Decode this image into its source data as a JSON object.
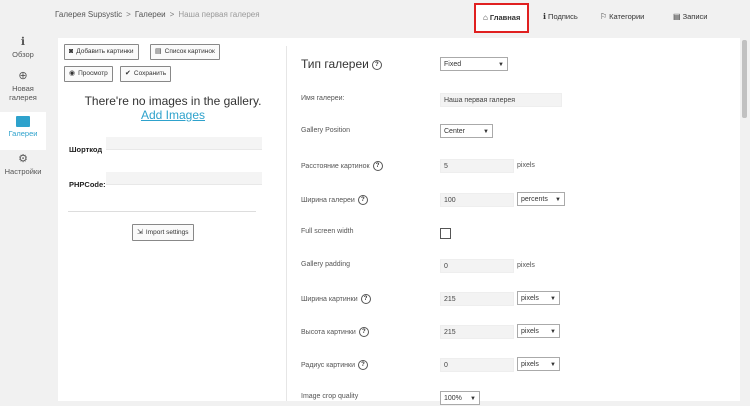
{
  "breadcrumb": {
    "root": "Галерея Supsystic",
    "section": "Галереи",
    "current": "Наша первая галерея",
    "separator": ">"
  },
  "topnav": {
    "home": {
      "icon": "home-icon",
      "glyph": "⌂",
      "label": "Главная"
    },
    "caption": {
      "icon": "info-icon",
      "glyph": "ℹ",
      "label": "Подпись"
    },
    "categories": {
      "icon": "bookmark-icon",
      "glyph": "⚐",
      "label": "Категории"
    },
    "posts": {
      "icon": "list-icon",
      "glyph": "▤",
      "label": "Записи"
    }
  },
  "sidebar": {
    "items": [
      {
        "icon": "info-icon",
        "glyph": "ℹ",
        "label": "Обзор"
      },
      {
        "icon": "plus-circle-icon",
        "glyph": "⊕",
        "label": "Новая галерея"
      },
      {
        "icon": "gallery-icon",
        "glyph": "",
        "label": "Галереи"
      },
      {
        "icon": "gear-icon",
        "glyph": "⚙",
        "label": "Настройки"
      }
    ]
  },
  "left_panel": {
    "buttons": {
      "add_images": {
        "icon": "camera-icon",
        "glyph": "◙",
        "label": "Добавить картинки"
      },
      "image_list": {
        "icon": "list-icon",
        "glyph": "▤",
        "label": "Список картинок"
      },
      "preview": {
        "icon": "eye-icon",
        "glyph": "◉",
        "label": "Просмотр"
      },
      "save": {
        "icon": "check-icon",
        "glyph": "✔",
        "label": "Сохранить"
      }
    },
    "empty_message": "There're no images in the gallery.",
    "add_images_link": "Add Images",
    "shortcode_label": "Шорткод",
    "phpcode_label": "PHPCode:",
    "import_button": {
      "icon": "import-icon",
      "glyph": "⇲",
      "label": "Import settings"
    }
  },
  "settings": {
    "title": "Тип галереи",
    "help": "?",
    "gallery_type": "Fixed",
    "gallery_name": {
      "label": "Имя галереи:",
      "value": "Наша первая галерея"
    },
    "gallery_position": {
      "label": "Gallery Position",
      "value": "Center"
    },
    "image_spacing": {
      "label": "Расстояние картинок",
      "value": "5",
      "unit": "pixels"
    },
    "gallery_width": {
      "label": "Ширина галереи",
      "value": "100",
      "unit": "percents"
    },
    "full_screen_width": {
      "label": "Full screen width",
      "checked": false
    },
    "gallery_padding": {
      "label": "Gallery padding",
      "value": "0",
      "unit": "pixels"
    },
    "image_width": {
      "label": "Ширина картинки",
      "value": "215",
      "unit": "pixels"
    },
    "image_height": {
      "label": "Высота картинки",
      "value": "215",
      "unit": "pixels"
    },
    "image_radius": {
      "label": "Радиус картинки",
      "value": "0",
      "unit": "pixels"
    },
    "image_crop_quality": {
      "label": "Image crop quality",
      "value": "100%"
    }
  },
  "colors": {
    "accent": "#2ea2cc",
    "highlight": "#e02020"
  }
}
